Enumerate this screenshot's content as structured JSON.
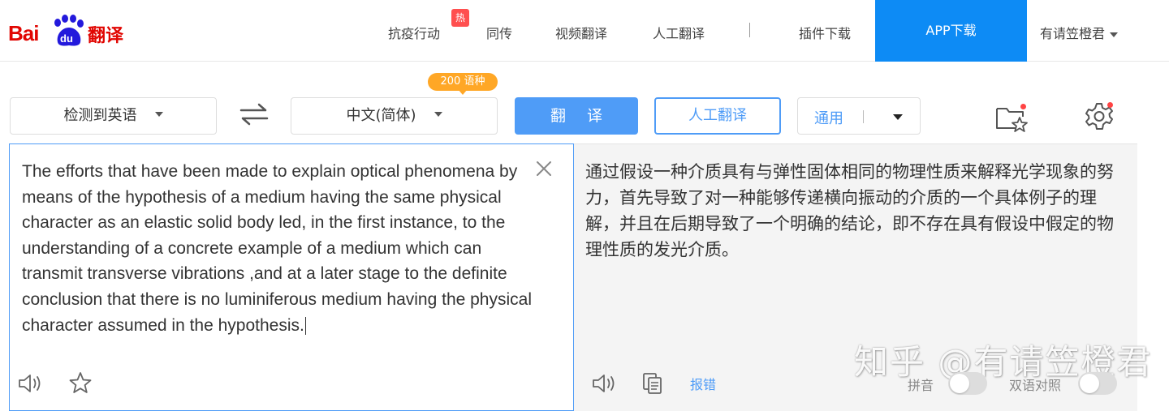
{
  "logo": {
    "text_prefix": "Bai",
    "du": "du",
    "cn": "翻译"
  },
  "nav": {
    "items": [
      "抗疫行动",
      "同传",
      "视频翻译",
      "人工翻译",
      "插件下载"
    ],
    "hot_badge": "热",
    "app_download": "APP下载",
    "user": "有请笠橙君"
  },
  "toolbar": {
    "source_lang": "检测到英语",
    "target_lang": "中文(简体)",
    "lang_count_badge": "200 语种",
    "translate_button": "翻译",
    "human_translate_button": "人工翻译",
    "domain": "通用"
  },
  "source": {
    "text": "The efforts that have been made to explain optical phenomena by means of the hypothesis of a medium having the same physical character as an elastic solid body led, in the first instance, to the understanding of a concrete example of a medium which can transmit transverse vibrations ,and at a later stage to the definite conclusion that there is no luminiferous medium having the physical character assumed in the hypothesis."
  },
  "target": {
    "text": "通过假设一种介质具有与弹性固体相同的物理性质来解释光学现象的努力，首先导致了对一种能够传递横向振动的介质的一个具体例子的理解，并且在后期导致了一个明确的结论，即不存在具有假设中假定的物理性质的发光介质。",
    "report": "报错",
    "pinyin_label": "拼音",
    "bilingual_label": "双语对照"
  },
  "watermark": "知乎 @有请笠橙君",
  "colors": {
    "accent": "#4f9cf7",
    "brand_red": "#e10602",
    "app_blue": "#0d8bf5",
    "badge_orange": "#ffa726"
  }
}
